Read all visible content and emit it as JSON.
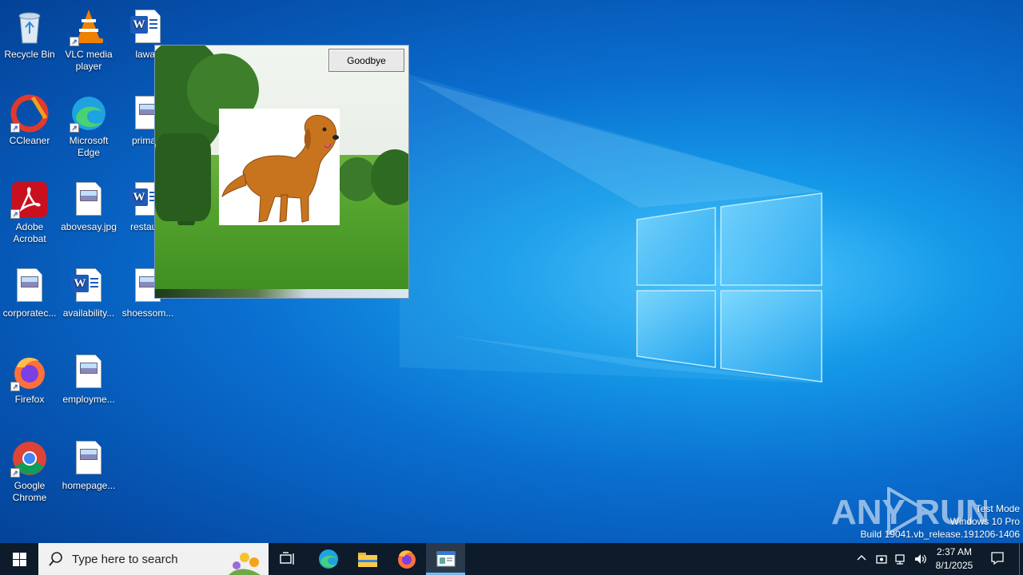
{
  "desktop": {
    "icons": [
      {
        "label": "Recycle Bin"
      },
      {
        "label": "VLC media player"
      },
      {
        "label": "lawan"
      },
      {
        "label": "CCleaner"
      },
      {
        "label": "Microsoft Edge"
      },
      {
        "label": "primary"
      },
      {
        "label": "Adobe Acrobat"
      },
      {
        "label": "abovesay.jpg"
      },
      {
        "label": "restaura"
      },
      {
        "label": "corporatec..."
      },
      {
        "label": "availability..."
      },
      {
        "label": "shoessom..."
      },
      {
        "label": "Firefox"
      },
      {
        "label": "employme..."
      },
      {
        "label": "Google Chrome"
      },
      {
        "label": "homepage..."
      }
    ]
  },
  "app_window": {
    "goodbye_label": "Goodbye"
  },
  "watermark": {
    "brand": "ANY RUN",
    "line1": "Test Mode",
    "line2": "Windows 10 Pro",
    "line3": "Build 19041.vb_release.191206-1406"
  },
  "taskbar": {
    "search_placeholder": "Type here to search",
    "time": "2:37 AM",
    "date": "8/1/2025"
  },
  "colors": {
    "taskbar": "#0d1b2a",
    "accent": "#76b9ed",
    "word_blue": "#1e5bb8"
  }
}
